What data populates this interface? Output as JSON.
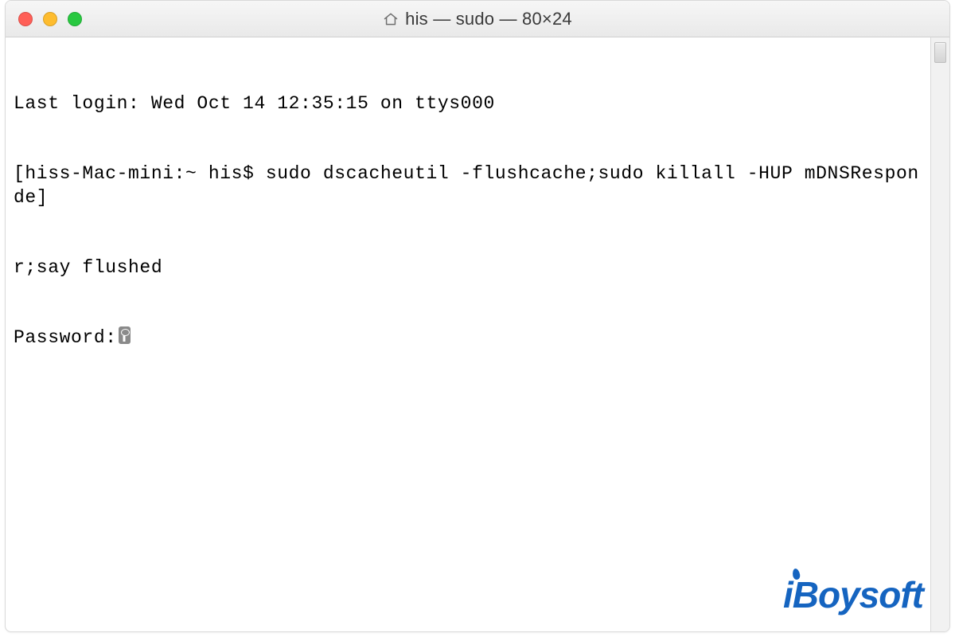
{
  "window": {
    "title": "his — sudo — 80×24"
  },
  "terminal": {
    "last_login": "Last login: Wed Oct 14 12:35:15 on ttys000",
    "prompt_line": "[hiss-Mac-mini:~ his$ sudo dscacheutil -flushcache;sudo killall -HUP mDNSResponde]",
    "wrap_line": "r;say flushed",
    "password_label": "Password:"
  },
  "watermark": {
    "text": "iBoysoft"
  },
  "colors": {
    "brand_blue": "#1564c0",
    "close_red": "#ff5f57",
    "min_yellow": "#febc2e",
    "max_green": "#28c840"
  }
}
